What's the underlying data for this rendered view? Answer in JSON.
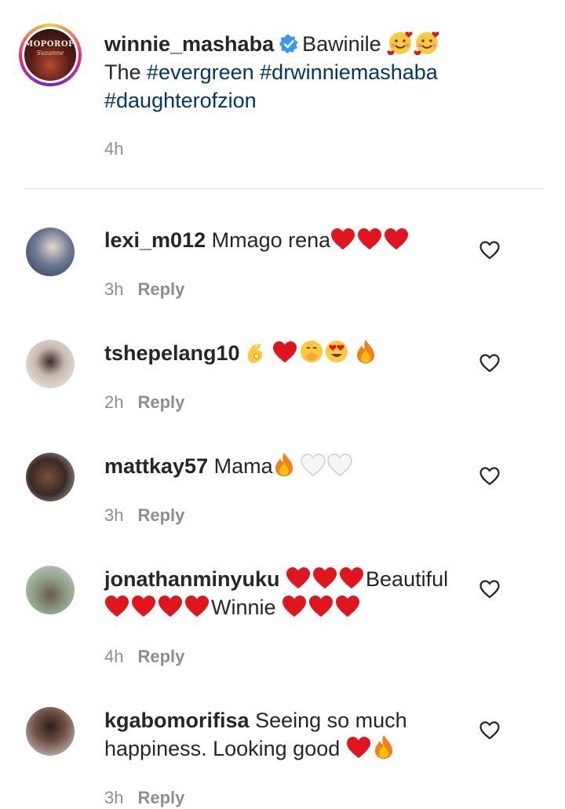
{
  "caption": {
    "username": "winnie_mashaba",
    "text": "Bawinile",
    "emojis": [
      "🥰",
      "🥰"
    ],
    "line2_prefix": "The ",
    "hashtags": [
      "#evergreen",
      "#drwinniemashaba",
      "#daughterofzion"
    ],
    "avatar_brand": "MOPOROFETA",
    "avatar_script": "Suzanne",
    "time": "4h"
  },
  "comments": [
    {
      "username": "lexi_m012",
      "text": "Mmago rena",
      "time": "3h",
      "reply_label": "Reply"
    },
    {
      "username": "tshepelang10",
      "text": "",
      "time": "2h",
      "reply_label": "Reply"
    },
    {
      "username": "mattkay57",
      "text": "Mama",
      "time": "3h",
      "reply_label": "Reply"
    },
    {
      "username": "jonathanminyuku",
      "text_a": "Beautiful",
      "text_b": "Winnie",
      "time": "4h",
      "reply_label": "Reply"
    },
    {
      "username": "kgabomorifisa",
      "text_a": "Seeing so much",
      "text_b": "happiness. Looking good",
      "time": "3h",
      "reply_label": "Reply"
    }
  ],
  "colors": {
    "hashtag": "#00376b",
    "verified": "#3897f0",
    "heart_red": "#e0151e",
    "meta_gray": "#8e8e8e"
  }
}
